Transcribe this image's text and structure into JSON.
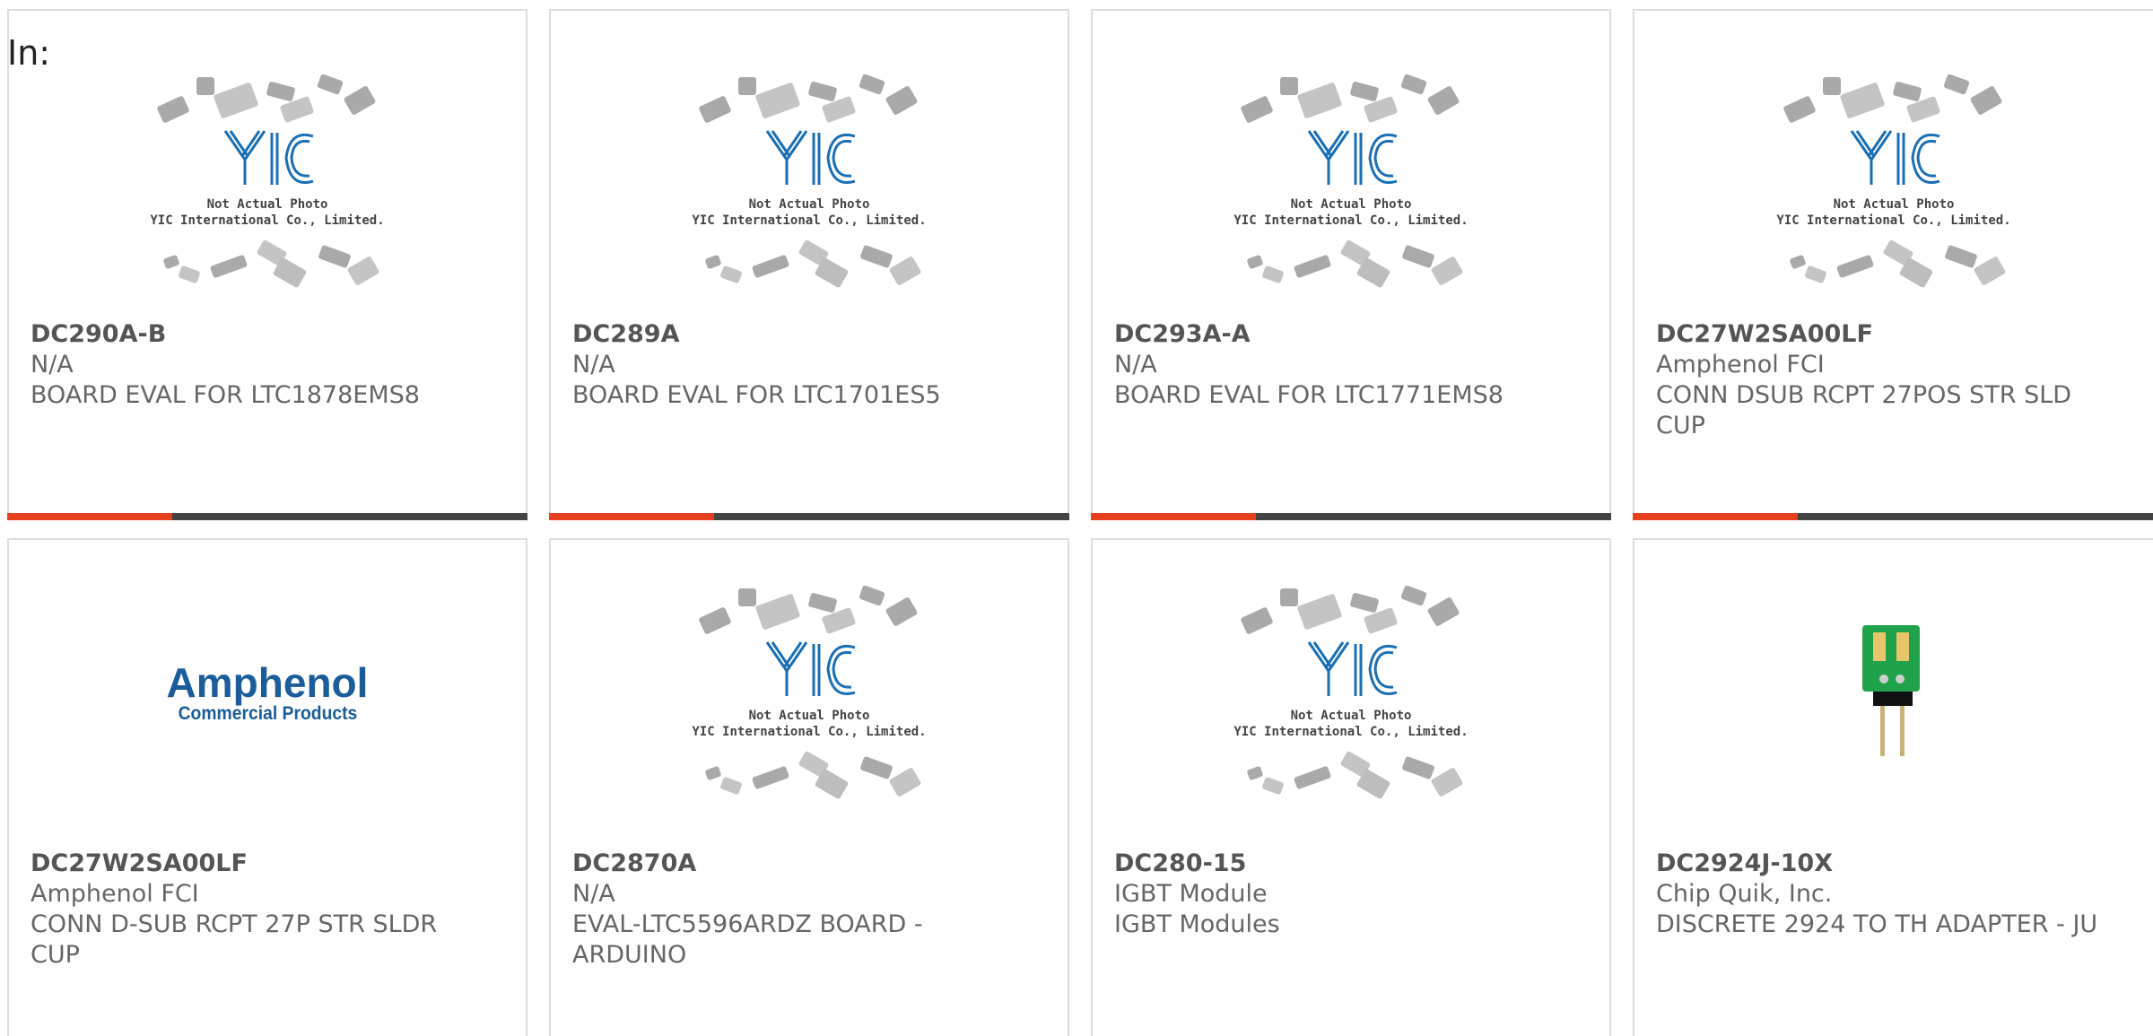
{
  "filter_label": "In:",
  "placeholder": {
    "line1": "Not Actual Photo",
    "line2": "YIC International Co., Limited."
  },
  "amphenol_logo": {
    "line1": "Amphenol",
    "line2": "Commercial Products"
  },
  "colors": {
    "accent": "#e8401c",
    "bar": "#444444",
    "border": "#dddddd",
    "yic_blue": "#1a6fb5"
  },
  "products": [
    {
      "part": "DC290A-B",
      "maker": "N/A",
      "desc": "BOARD EVAL FOR LTC1878EMS8",
      "image": "placeholder"
    },
    {
      "part": "DC289A",
      "maker": "N/A",
      "desc": "BOARD EVAL FOR LTC1701ES5",
      "image": "placeholder"
    },
    {
      "part": "DC293A-A",
      "maker": "N/A",
      "desc": "BOARD EVAL FOR LTC1771EMS8",
      "image": "placeholder"
    },
    {
      "part": "DC27W2SA00LF",
      "maker": "Amphenol FCI",
      "desc": "CONN DSUB RCPT 27POS STR SLD CUP",
      "image": "placeholder"
    },
    {
      "part": "DC27W2SA00LF",
      "maker": "Amphenol FCI",
      "desc": "CONN D-SUB RCPT 27P STR SLDR CUP",
      "image": "amphenol-logo"
    },
    {
      "part": "DC2870A",
      "maker": "N/A",
      "desc": "EVAL-LTC5596ARDZ BOARD - ARDUINO",
      "image": "placeholder"
    },
    {
      "part": "DC280-15",
      "maker": "IGBT Module",
      "desc": "IGBT Modules",
      "image": "placeholder"
    },
    {
      "part": "DC2924J-10X",
      "maker": "Chip Quik, Inc.",
      "desc": "DISCRETE 2924 TO TH ADAPTER - JU",
      "image": "adapter-photo"
    }
  ]
}
